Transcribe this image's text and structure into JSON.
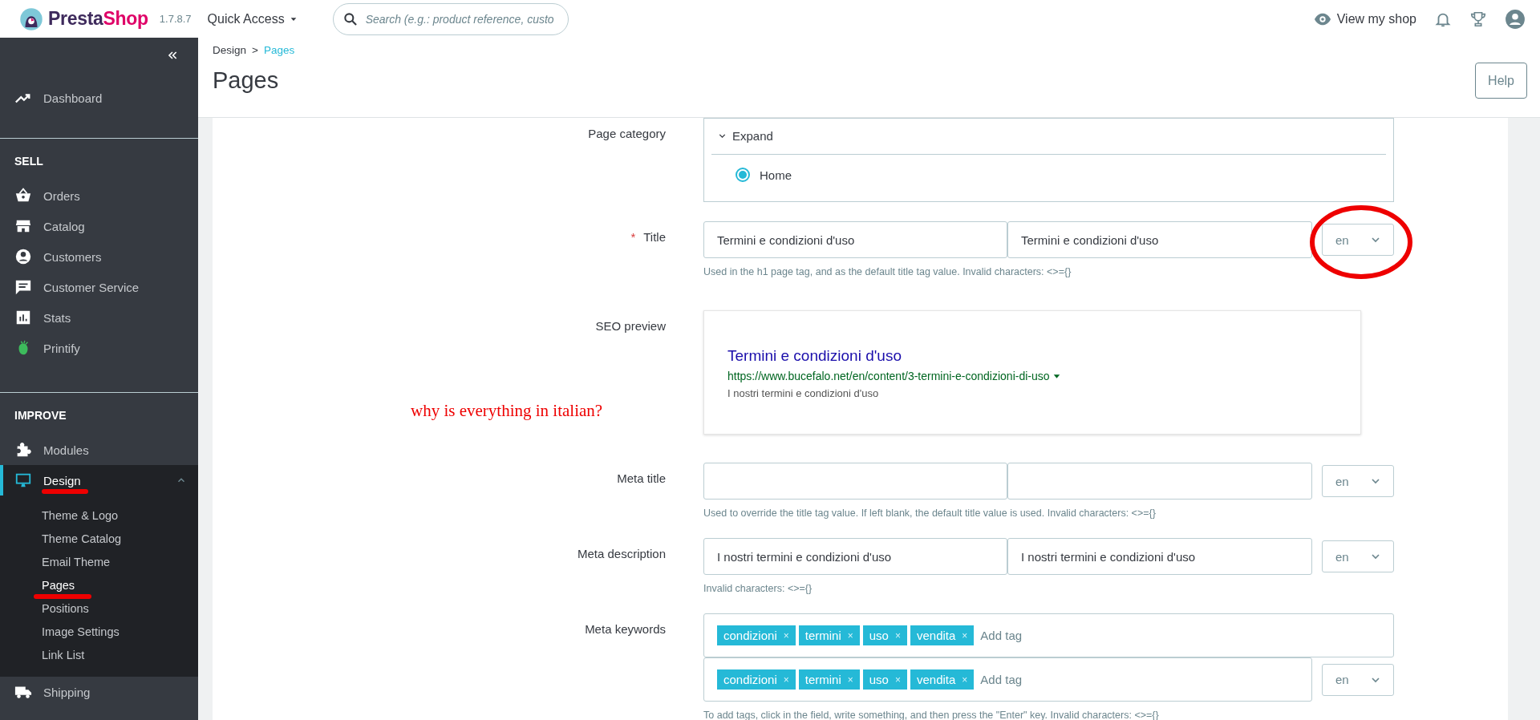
{
  "topbar": {
    "logo_parts": [
      "Presta",
      "Shop"
    ],
    "version": "1.7.8.7",
    "quick_access": "Quick Access",
    "search": {
      "placeholder": "Search (e.g.: product reference, custo"
    },
    "view_shop": "View my shop"
  },
  "sidebar": {
    "sections": [
      {
        "items": [
          {
            "label": "Dashboard",
            "selected": false
          }
        ]
      },
      {
        "heading": "SELL",
        "items": [
          {
            "label": "Orders",
            "selected": false
          },
          {
            "label": "Catalog",
            "selected": false
          },
          {
            "label": "Customers",
            "selected": false
          },
          {
            "label": "Customer Service",
            "selected": false
          },
          {
            "label": "Stats",
            "selected": false
          },
          {
            "label": "Printify",
            "selected": false
          }
        ]
      },
      {
        "heading": "IMPROVE",
        "items": [
          {
            "label": "Modules",
            "selected": false
          },
          {
            "label": "Design",
            "selected": true,
            "expanded": true,
            "children": [
              {
                "label": "Theme & Logo",
                "selected": false
              },
              {
                "label": "Theme Catalog",
                "selected": false
              },
              {
                "label": "Email Theme",
                "selected": false
              },
              {
                "label": "Pages",
                "selected": true
              },
              {
                "label": "Positions",
                "selected": false
              },
              {
                "label": "Image Settings",
                "selected": false
              },
              {
                "label": "Link List",
                "selected": false
              }
            ]
          },
          {
            "label": "Shipping",
            "selected": false
          }
        ]
      }
    ]
  },
  "header": {
    "breadcrumb": [
      "Design",
      "Pages"
    ],
    "separator": ">",
    "title": "Pages",
    "help": "Help"
  },
  "form": {
    "rows": [
      {
        "kind": "category",
        "label": "Page category",
        "expand": "Expand",
        "options": [
          {
            "label": "Home",
            "selected": true
          }
        ]
      },
      {
        "kind": "translatable",
        "label": "Title",
        "required_mark": "*",
        "fields": [
          {
            "kind": "input",
            "value": "Termini e condizioni d'uso"
          },
          {
            "kind": "input",
            "value": "Termini e condizioni d'uso"
          }
        ],
        "language": "en",
        "hint": "Used in the h1 page tag, and as the default title tag value. Invalid characters: <>={}"
      },
      {
        "kind": "preview",
        "label": "SEO preview",
        "title": "Termini e condizioni d'uso",
        "url": "https://www.bucefalo.net/en/content/3-termini-e-condizioni-di-uso",
        "description": "I nostri termini e condizioni d'uso"
      },
      {
        "kind": "translatable",
        "label": "Meta title",
        "fields": [
          {
            "kind": "input"
          },
          {
            "kind": "input"
          }
        ],
        "language": "en",
        "hint": "Used to override the title tag value. If left blank, the default title value is used. Invalid characters: <>={}"
      },
      {
        "kind": "translatable",
        "label": "Meta description",
        "fields": [
          {
            "kind": "input",
            "value": "I nostri termini e condizioni d'uso"
          },
          {
            "kind": "input",
            "value": "I nostri termini e condizioni d'uso"
          }
        ],
        "language": "en",
        "hint": "Invalid characters: <>={}"
      },
      {
        "kind": "tags",
        "label": "Meta keywords",
        "boxes": [
          {
            "tags": [
              {
                "label": "condizioni",
                "remove": "×"
              },
              {
                "label": "termini",
                "remove": "×"
              },
              {
                "label": "uso",
                "remove": "×"
              },
              {
                "label": "vendita",
                "remove": "×"
              }
            ],
            "placeholder": "Add tag"
          },
          {
            "tags": [
              {
                "label": "condizioni",
                "remove": "×"
              },
              {
                "label": "termini",
                "remove": "×"
              },
              {
                "label": "uso",
                "remove": "×"
              },
              {
                "label": "vendita",
                "remove": "×"
              }
            ],
            "placeholder": "Add tag",
            "language": "en"
          }
        ],
        "hint": "To add tags, click in the field, write something, and then press the \"Enter\" key. Invalid characters: <>={}"
      }
    ]
  },
  "annotations": [
    {
      "text": "why is everything in italian?"
    }
  ]
}
